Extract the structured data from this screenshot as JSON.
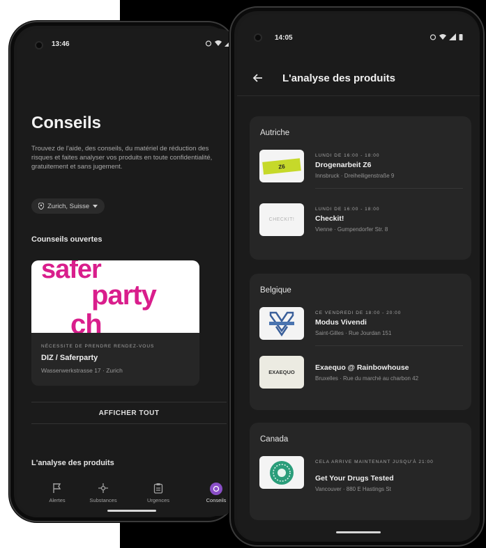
{
  "left": {
    "status_time": "13:46",
    "title": "Conseils",
    "description": "Trouvez de l'aide, des conseils, du matériel de réduction des risques et faites analyser vos produits en toute confidentialité, gratuitement et sans jugement.",
    "location_chip": "Zurich, Suisse",
    "section_open": "Counseils ouvertes",
    "card": {
      "image_text_1": "safer",
      "image_text_2": "party",
      "image_text_3": "ch",
      "meta": "NÉCESSITE DE PRENDRE RENDEZ-VOUS",
      "name": "DIZ / Saferparty",
      "address": "Wasserwerkstrasse 17 · Zurich"
    },
    "show_all": "AFFICHER TOUT",
    "section_analysis": "L'analyse des produits",
    "nav": [
      {
        "label": "Alertes",
        "icon": "flag-icon"
      },
      {
        "label": "Substances",
        "icon": "molecule-icon"
      },
      {
        "label": "Urgences",
        "icon": "clipboard-icon"
      },
      {
        "label": "Conseils",
        "icon": "counsel-icon"
      }
    ]
  },
  "right": {
    "status_time": "14:05",
    "title": "L'analyse des produits",
    "groups": [
      {
        "country": "Autriche",
        "entries": [
          {
            "meta": "LUNDI DE 16:00 - 18:00",
            "name": "Drogenarbeit Z6",
            "address": "Innsbruck · Dreiheiligenstraße 9",
            "logo_text": "Z6"
          },
          {
            "meta": "LUNDI DE 16:00 - 18:00",
            "name": "Checkit!",
            "address": "Vienne · Gumpendorfer Str. 8",
            "logo_text": "CHECKIT!"
          }
        ]
      },
      {
        "country": "Belgique",
        "entries": [
          {
            "meta": "CE VENDREDI DE 18:00 - 20:00",
            "name": "Modus Vivendi",
            "address": "Saint-Gilles · Rue Jourdan 151",
            "logo_text": "MV"
          },
          {
            "meta": "",
            "name": "Exaequo @ Rainbowhouse",
            "address": "Bruxelles · Rue du marché au charbon 42",
            "logo_text": "EXAEQUO"
          }
        ]
      },
      {
        "country": "Canada",
        "entries": [
          {
            "meta": "CELA ARRIVE MAINTENANT JUSQU'À 21:00",
            "name": "Get Your Drugs Tested",
            "address": "Vancouver · 880 E Hastings St",
            "logo_text": ""
          }
        ]
      }
    ]
  },
  "colors": {
    "accent": "#8a4fc7",
    "saferparty_pink": "#d91e8c",
    "background": "#1b1b1b",
    "card": "#262626"
  }
}
